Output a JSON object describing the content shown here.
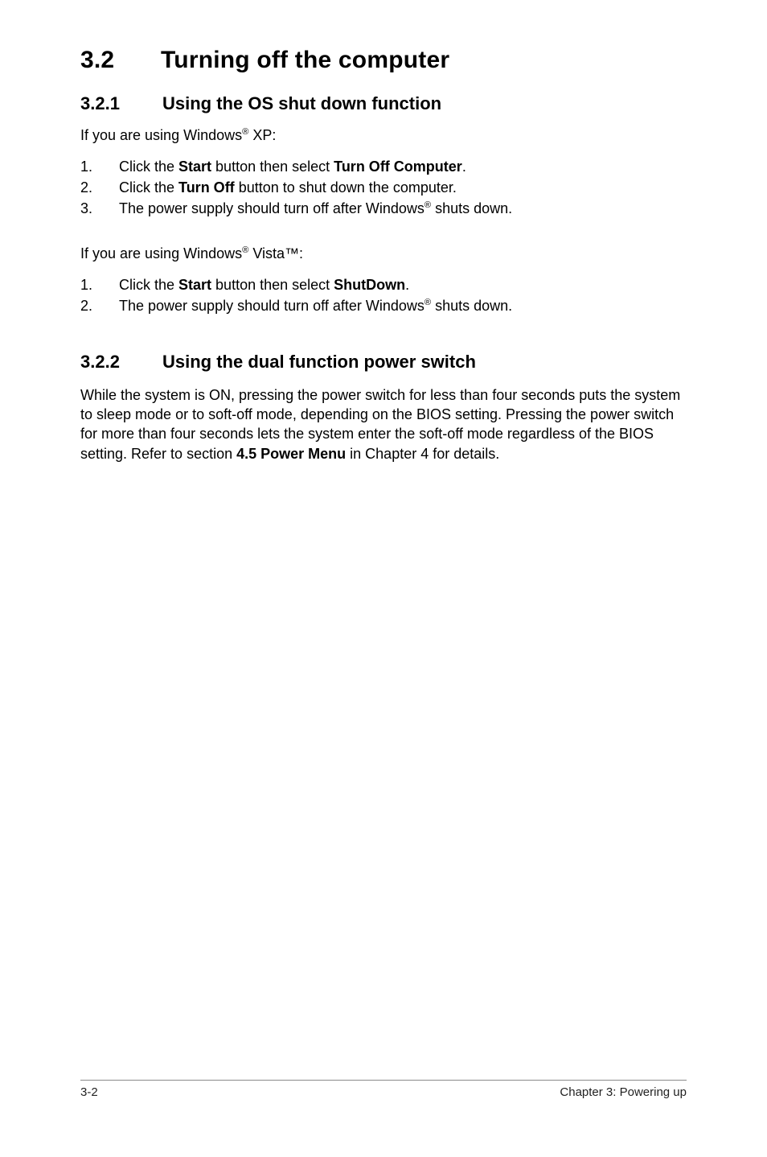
{
  "heading": {
    "num": "3.2",
    "title": "Turning off the computer"
  },
  "s321": {
    "num": "3.2.1",
    "title": "Using the OS shut down function",
    "intro_xp_pre": "If you are using Windows",
    "intro_xp_sup": "®",
    "intro_xp_post": " XP:",
    "xp_steps": [
      {
        "n": "1.",
        "pre": "Click the ",
        "b1": "Start",
        "mid": " button then select ",
        "b2": "Turn Off Computer",
        "post": "."
      },
      {
        "n": "2.",
        "pre": "Click the ",
        "b1": "Turn Off",
        "mid": " button to shut down the computer.",
        "b2": "",
        "post": ""
      },
      {
        "n": "3.",
        "pre": "The power supply should turn off after Windows",
        "sup": "®",
        "post": " shuts down."
      }
    ],
    "intro_vista_pre": "If you are using Windows",
    "intro_vista_sup": "®",
    "intro_vista_post": " Vista™:",
    "vista_steps": [
      {
        "n": "1.",
        "pre": "Click the ",
        "b1": "Start",
        "mid": " button then select ",
        "b2": "ShutDown",
        "post": "."
      },
      {
        "n": "2.",
        "pre": "The power supply should turn off after Windows",
        "sup": "®",
        "post": " shuts down."
      }
    ]
  },
  "s322": {
    "num": "3.2.2",
    "title": "Using the dual function power switch",
    "para_pre": "While the system is ON, pressing the power switch for less than four seconds puts the system to sleep mode or to soft-off mode, depending on the BIOS setting. Pressing the power switch for more than four seconds lets the system enter the soft-off mode regardless of the BIOS setting. Refer to section ",
    "para_bold": "4.5 Power Menu ",
    "para_post": " in Chapter 4 for details."
  },
  "footer": {
    "left": "3-2",
    "right": "Chapter 3: Powering up"
  }
}
